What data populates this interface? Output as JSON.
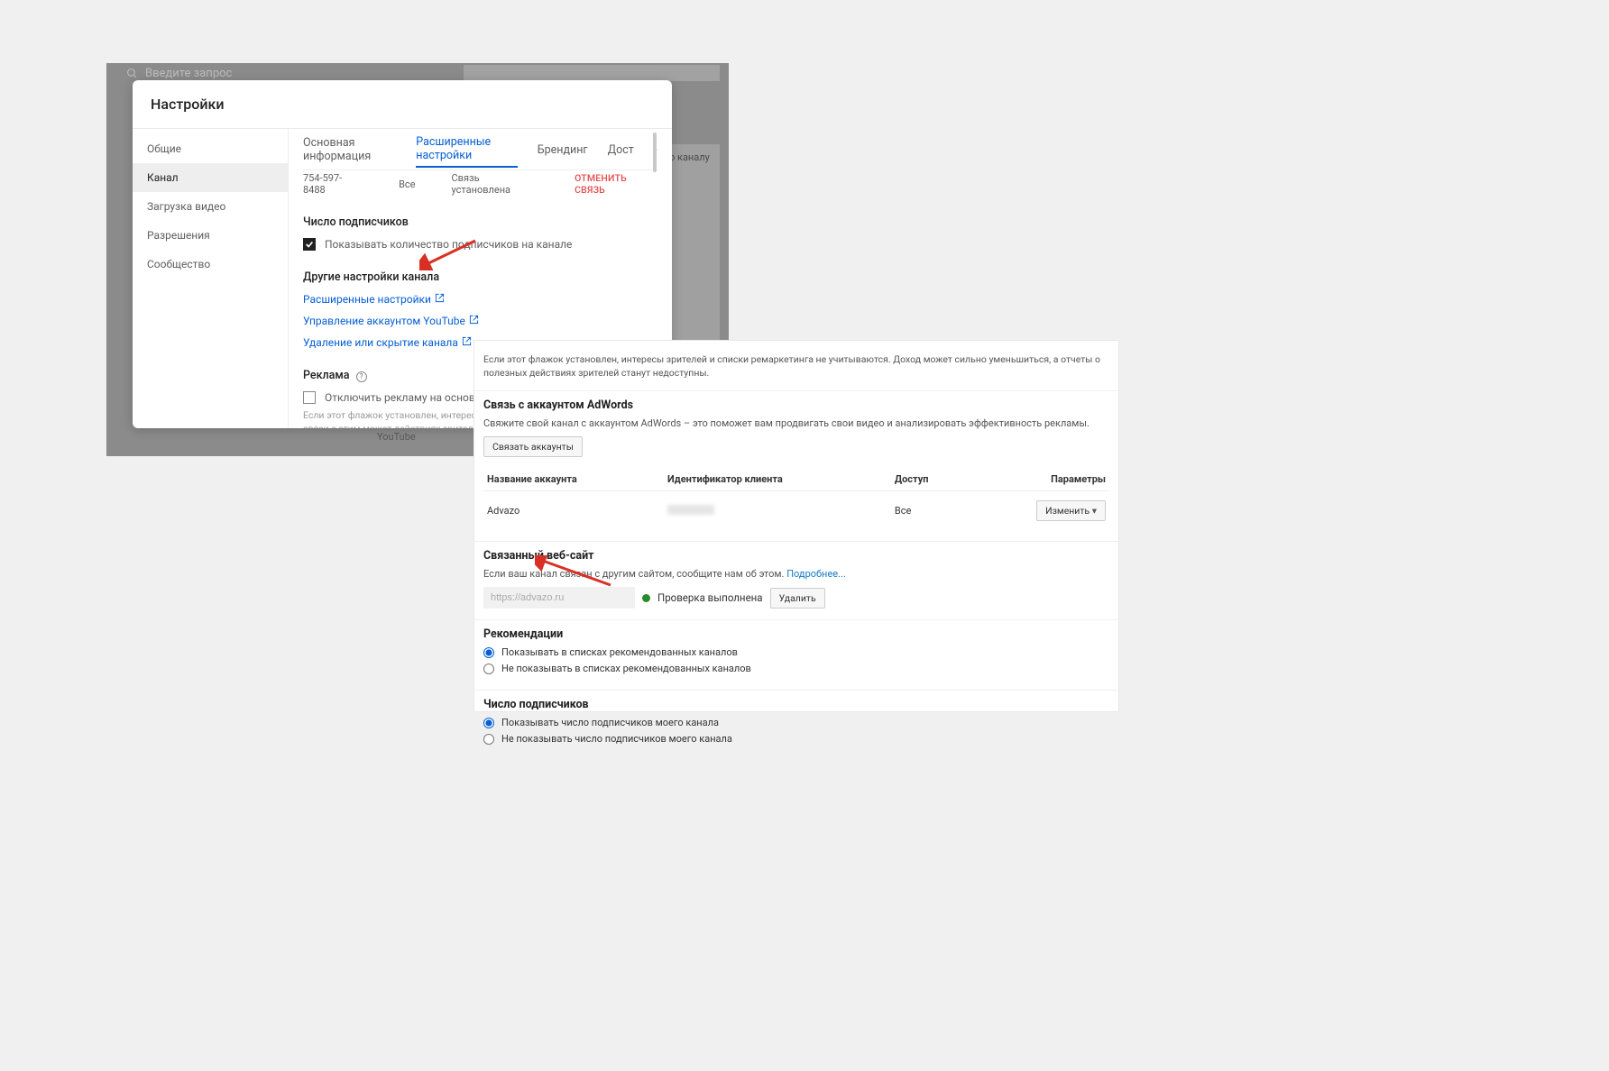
{
  "bg": {
    "search_placeholder": "Введите запрос",
    "panel_heading_fragment": "о каналу",
    "youtube": "YouTube"
  },
  "modal": {
    "title": "Настройки",
    "sidebar": {
      "items": [
        {
          "label": "Общие"
        },
        {
          "label": "Канал"
        },
        {
          "label": "Загрузка видео"
        },
        {
          "label": "Разрешения"
        },
        {
          "label": "Сообщество"
        }
      ]
    },
    "tabs": [
      {
        "label": "Основная информация"
      },
      {
        "label": "Расширенные настройки"
      },
      {
        "label": "Брендинг"
      },
      {
        "label": "Дост"
      }
    ],
    "phone_row": {
      "phone": "754-597-8488",
      "all": "Все",
      "status": "Связь установлена",
      "cancel": "ОТМЕНИТЬ СВЯЗЬ"
    },
    "subscribers": {
      "heading": "Число подписчиков",
      "checkbox_label": "Показывать количество подписчиков на канале"
    },
    "other": {
      "heading": "Другие настройки канала",
      "links": {
        "advanced": "Расширенные настройки",
        "manage_account": "Управление аккаунтом YouTube",
        "delete_hide": "Удаление или скрытие канала"
      }
    },
    "ads": {
      "heading": "Реклама",
      "checkbox_label": "Отключить рекламу на основе ин",
      "fine": "Если этот флажок установлен, интересы зрите рекламы в ваших видео. В связи с этим может действиях зрителей станут недоступны."
    }
  },
  "panel2": {
    "top_fine": "Если этот флажок установлен, интересы зрителей и списки ремаркетинга не учитываются. Доход может сильно уменьшиться, а отчеты о полезных действиях зрителей станут недоступны.",
    "adwords": {
      "heading": "Связь с аккаунтом AdWords",
      "sub": "Свяжите свой канал с аккаунтом AdWords – это поможет вам продвигать свои видео и анализировать эффективность рекламы.",
      "link_btn": "Связать аккаунты",
      "cols": {
        "name": "Название аккаунта",
        "id": "Идентификатор клиента",
        "access": "Доступ",
        "params": "Параметры"
      },
      "row": {
        "name": "Advazo",
        "access": "Все",
        "edit": "Изменить"
      }
    },
    "site": {
      "heading": "Связанный веб-сайт",
      "sub": "Если ваш канал связан с другим сайтом, сообщите нам об этом.",
      "learn_more": "Подробнее...",
      "input_value": "https://advazo.ru",
      "verified": "Проверка выполнена",
      "delete": "Удалить"
    },
    "reco": {
      "heading": "Рекомендации",
      "opt1": "Показывать в списках рекомендованных каналов",
      "opt2": "Не показывать в списках рекомендованных каналов"
    },
    "subs": {
      "heading": "Число подписчиков",
      "opt1": "Показывать число подписчиков моего канала",
      "opt2": "Не показывать число подписчиков моего канала"
    }
  }
}
